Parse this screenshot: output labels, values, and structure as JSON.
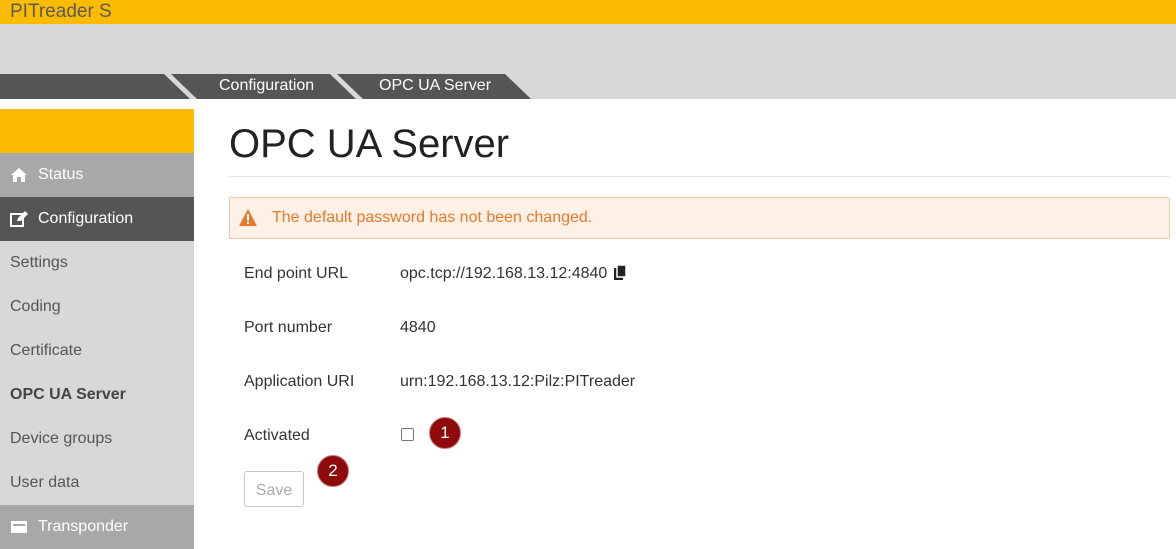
{
  "app": {
    "title": "PITreader S"
  },
  "breadcrumbs": [
    "Configuration",
    "OPC UA Server"
  ],
  "sidebar": {
    "items": [
      {
        "label": "Status",
        "icon": "home-icon"
      },
      {
        "label": "Configuration",
        "icon": "edit-icon"
      },
      {
        "label": "Settings"
      },
      {
        "label": "Coding"
      },
      {
        "label": "Certificate"
      },
      {
        "label": "OPC UA Server"
      },
      {
        "label": "Device groups"
      },
      {
        "label": "User data"
      },
      {
        "label": "Transponder",
        "icon": "card-icon"
      }
    ]
  },
  "page": {
    "title": "OPC UA Server",
    "alert": "The default password has not been changed.",
    "fields": [
      {
        "label": "End point URL",
        "value": "opc.tcp://192.168.13.12:4840"
      },
      {
        "label": "Port number",
        "value": "4840"
      },
      {
        "label": "Application URI",
        "value": "urn:192.168.13.12:Pilz:PITreader"
      },
      {
        "label": "Activated",
        "checked": false
      }
    ],
    "save_label": "Save",
    "badges": [
      "1",
      "2"
    ]
  },
  "colors": {
    "brand_yellow": "#fbbb00",
    "sidebar_active": "#555555",
    "alert_text": "#e8782a",
    "badge": "#8f0b0b"
  }
}
